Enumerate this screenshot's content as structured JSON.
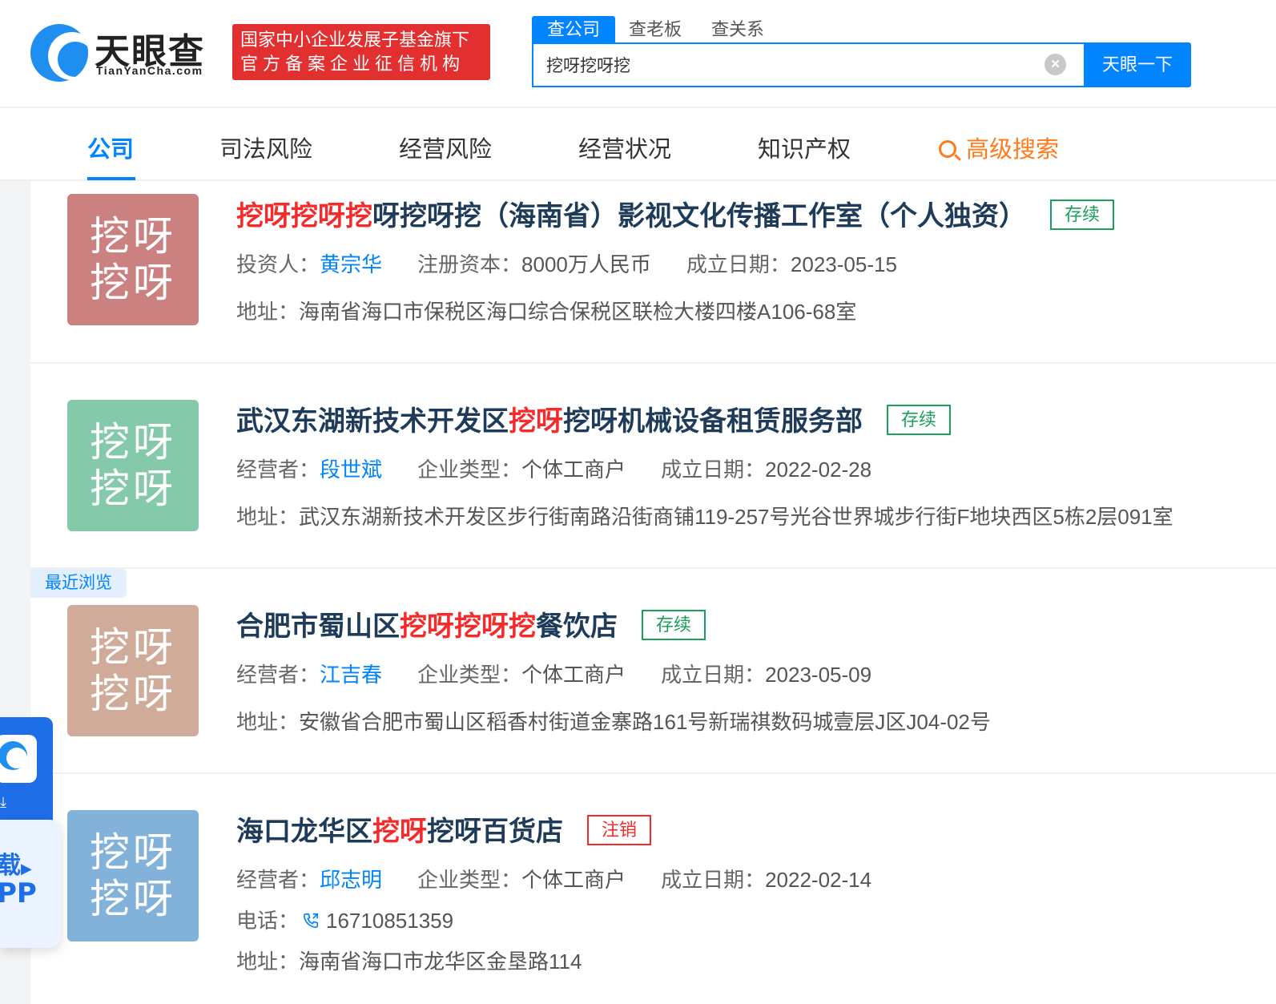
{
  "header": {
    "logo_text": "天眼查",
    "logo_sub": "TianYanCha.com",
    "cert_line1": "国家中小企业发展子基金旗下",
    "cert_line2": "官方备案企业征信机构",
    "search_tabs": [
      "查公司",
      "查老板",
      "查关系"
    ],
    "search_value": "挖呀挖呀挖",
    "search_button": "天眼一下"
  },
  "nav": {
    "items": [
      "公司",
      "司法风险",
      "经营风险",
      "经营状况",
      "知识产权"
    ],
    "advanced": "高级搜索"
  },
  "recent_tag": "最近浏览",
  "app_widget": {
    "line1": "载",
    "line2": "PP"
  },
  "companies": [
    {
      "avatar_line1": "挖呀",
      "avatar_line2": "挖呀",
      "avatar_color": "#cb8180",
      "title_hl": "挖呀挖呀挖",
      "title_rest": "呀挖呀挖（海南省）影视文化传播工作室（个人独资）",
      "status": "存续",
      "k1": "投资人：",
      "v1": "黄宗华",
      "k2": "注册资本：",
      "v2": "8000万人民币",
      "k3": "成立日期：",
      "v3": "2023-05-15",
      "address_label": "地址：",
      "address": "海南省海口市保税区海口综合保税区联检大楼四楼A106-68室"
    },
    {
      "avatar_line1": "挖呀",
      "avatar_line2": "挖呀",
      "avatar_color": "#84c9aa",
      "title_pre": "武汉东湖新技术开发区",
      "title_hl": "挖呀",
      "title_rest": "挖呀机械设备租赁服务部",
      "status": "存续",
      "k1": "经营者：",
      "v1": "段世斌",
      "k2": "企业类型：",
      "v2": "个体工商户",
      "k3": "成立日期：",
      "v3": "2022-02-28",
      "address_label": "地址：",
      "address": "武汉东湖新技术开发区步行街南路沿街商铺119-257号光谷世界城步行街F地块西区5栋2层091室"
    },
    {
      "avatar_line1": "挖呀",
      "avatar_line2": "挖呀",
      "avatar_color": "#d0ab9a",
      "title_pre": "合肥市蜀山区",
      "title_hl": "挖呀挖呀挖",
      "title_rest": "餐饮店",
      "status": "存续",
      "k1": "经营者：",
      "v1": "江吉春",
      "k2": "企业类型：",
      "v2": "个体工商户",
      "k3": "成立日期：",
      "v3": "2023-05-09",
      "address_label": "地址：",
      "address": "安徽省合肥市蜀山区稻香村街道金寨路161号新瑞祺数码城壹层J区J04-02号"
    },
    {
      "avatar_line1": "挖呀",
      "avatar_line2": "挖呀",
      "avatar_color": "#82b2d9",
      "title_pre": "海口龙华区",
      "title_hl": "挖呀",
      "title_rest": "挖呀百货店",
      "status": "注销",
      "k1": "经营者：",
      "v1": "邱志明",
      "k2": "企业类型：",
      "v2": "个体工商户",
      "k3": "成立日期：",
      "v3": "2022-02-14",
      "phone_label": "电话：",
      "phone": "16710851359",
      "address_label": "地址：",
      "address": "海南省海口市龙华区金垦路114"
    }
  ]
}
